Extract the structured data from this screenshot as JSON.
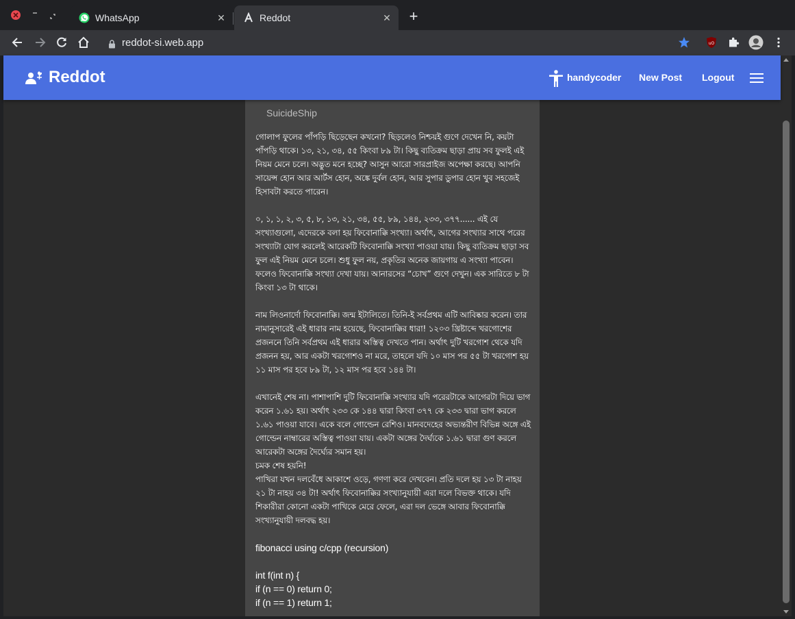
{
  "browser": {
    "tabs": [
      {
        "title": "WhatsApp",
        "favicon": "whatsapp-icon",
        "active": false
      },
      {
        "title": "Reddot",
        "favicon": "reddot-favicon-icon",
        "active": true
      }
    ],
    "new_tab_label": "+",
    "close_glyph": "✕",
    "url": "reddot-si.web.app"
  },
  "app": {
    "brand": "Reddot",
    "username": "handycoder",
    "nav": {
      "new_post": "New Post",
      "logout": "Logout"
    },
    "accent_color": "#4a6fe0"
  },
  "post": {
    "cut_line": "— — — — — — — —",
    "author": "SuicideShip",
    "paragraphs": [
      " গোলাপ ফুলের পাঁপড়ি ছিড়েছেন কখনো? ছিড়লেও নিশ্চয়ই গুণে দেখেন নি, কয়টা পাঁপড়ি থাকে। ১৩, ২১, ৩৪, ৫৫ কিংবা ৮৯ টা। কিছু ব্যতিক্রম ছাড়া প্রায় সব ফুলই এই নিয়ম মেনে চলে। অদ্ভুত মনে হচ্ছে? আসুন আরো সারপ্রাইজ অপেক্ষা করছে। আপনি সায়েন্স হোন আর আর্টস হোন, অঙ্কে দুর্বল হোন, আর সুপার ডুপার হোন খুব সহজেই হিসাবটা করতে পারেন।",
      "০, ১, ১, ২, ৩, ৫, ৮, ১৩, ২১, ৩৪, ৫৫, ৮৯, ১৪৪, ২৩৩, ৩৭৭...... এই যে সংখ্যাগুলো, এদেরকে বলা হয় ফিবোনাক্কি সংখ্যা। অর্থাৎ, আগের সংখ্যার সাথে পরের সংখ্যাটা যোগ করলেই আরেকটি ফিবোনাক্কি সংখ্যা পাওয়া যায়। কিছু ব্যতিক্রম ছাড়া সব ফুল এই নিয়ম মেনে চলে। শুধু ফুল নয়, প্রকৃতির অনেক জায়গায় এ সংখ্যা পাবেন। ফলেও ফিবোনাক্কি সংখ্যা দেখা যায়। আনারসের “চোখ” গুণে দেখুন। এক সারিতে ৮ টা কিংবা ১৩ টা থাকে।",
      "নাম লিওনার্দো ফিবোনাক্কি। জন্ম ইটালিতে। তিনি-ই সর্বপ্রথম এটি আবিষ্কার করেন। তার নামানুসারেই এই ধারার নাম হয়েছে, ফিবোনাক্কির ধারা! ১২০৩ খ্রিষ্টাব্দে খরগোশের প্রজননে তিনি সর্বপ্রথম এই ধারার অস্তিত্ব দেখতে পান। অর্থাৎ দুটি খরগোশ থেকে যদি প্রজনন হয়, আর একটা খরগোশও না মরে, তাহলে যদি ১০ মাস পর ৫৫ টা খরগোশ হয় ১১ মাস পর হবে ৮৯ টা, ১২ মাস পর হবে ১৪৪ টা।",
      "এখানেই শেষ না। পাশাপাশি দুটি ফিবোনাক্কি সংখ্যার যদি পরেরটাকে আগেরটা দিয়ে ভাগ করেন ১.৬১ হয়। অর্থাৎ ২৩৩ কে ১৪৪ দ্বারা কিংবা ৩৭৭ কে ২৩৩ দ্বারা ভাগ করলে ১.৬১ পাওয়া যাবে। একে বলে গোল্ডেন রেশিও। মানবদেহের অভ্যন্তরীণ বিভিন্ন অঙ্গে এই গোল্ডেন নাম্বারের অস্তিত্ব পাওয়া যায়। একটা অঙ্গের দৈর্ঘ্যকে ১.৬১ দ্বারা গুণ করলে আরেকটা অঙ্গের দৈর্ঘ্যের সমান হয়।",
      "চমক শেষ হয়নি!",
      "পাখিরা যখন দলবেঁধে আকাশে ওড়ে, গণণা করে দেখবেন। প্রতি দলে হয় ১৩ টা নাহয় ২১ টা নাহয় ৩৪ টা! অর্থাৎ ফিবোনাক্কির সংখ্যানুযায়ী এরা দলে বিভক্ত থাকে। যদি শিকারীরা কোনো একটা পাখিকে মেরে ফেলে, এরা দল ভেঙ্গে আবার ফিবোনাক্কি সংখ্যানুযায়ী দলবদ্ধ হয়।"
    ],
    "code_title": "fibonacci using c/cpp (recursion)",
    "code_lines": [
      "int f(int n) {",
      "if (n == 0) return 0;",
      "if (n == 1) return 1;"
    ]
  }
}
